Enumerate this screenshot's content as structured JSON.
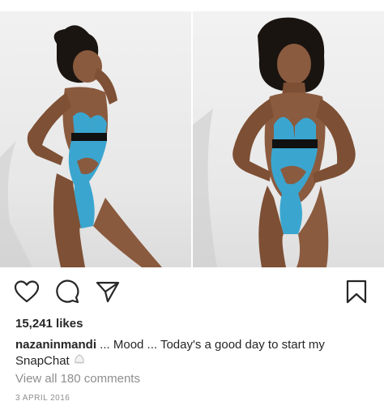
{
  "post": {
    "likes": "15,241 likes",
    "username": "nazaninmandi",
    "caption_text": " ... Mood ... Today's a good day to start my SnapChat",
    "view_comments": "View all 180 comments",
    "date": "3 APRIL 2016"
  },
  "icons": {
    "like": "heart-icon",
    "comment": "comment-bubble-icon",
    "share": "paper-plane-icon",
    "save": "bookmark-icon",
    "emoji": "ghost-emoji-icon"
  },
  "colors": {
    "text": "#262626",
    "muted": "#8e8e8e",
    "swimsuit": "#3aa6d0"
  }
}
